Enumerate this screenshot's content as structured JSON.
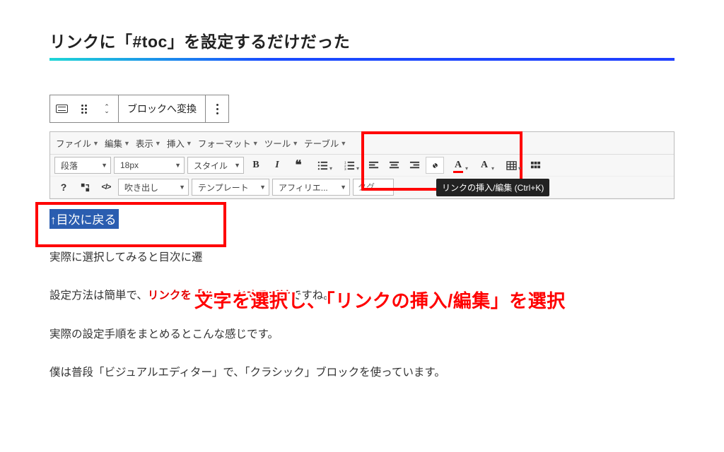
{
  "section_title": "リンクに「#toc」を設定するだけだった",
  "block_toolbar": {
    "convert_label": "ブロックへ変換"
  },
  "menu": {
    "file": "ファイル",
    "edit": "編集",
    "view": "表示",
    "insert": "挿入",
    "format": "フォーマット",
    "tools": "ツール",
    "table": "テーブル"
  },
  "toolbar": {
    "paragraph": "段落",
    "fontsize": "18px",
    "style": "スタイル",
    "speech": "吹き出し",
    "template": "テンプレート",
    "affiliate": "アフィリエ...",
    "tag_placeholder": "タグ"
  },
  "tooltip": "リンクの挿入/編集 (Ctrl+K)",
  "selected_text": "↑目次に戻る",
  "overlay": "文字を選択し、「リンクの挿入/編集」を選択",
  "paragraphs": {
    "p1_prefix": "実際に選択してみると目次に遷",
    "p2_prefix": "設定方法は簡単で、",
    "p2_red": "リンクを「#toc」とするだけ",
    "p2_suffix": "ですね。",
    "p3": "実際の設定手順をまとめるとこんな感じです。",
    "p4": "僕は普段「ビジュアルエディター」で、「クラシック」ブロックを使っています。"
  }
}
